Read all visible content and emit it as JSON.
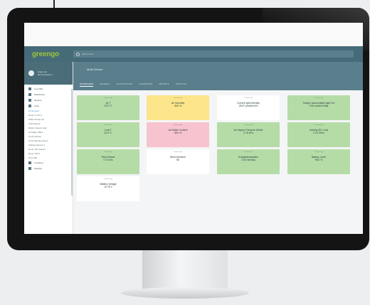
{
  "app": {
    "logo": "greengo",
    "search_placeholder": "Search here"
  },
  "user": {
    "name": "Hugo Lee",
    "company": "HQ Company ▾"
  },
  "sidebar": {
    "items": [
      {
        "label": "Live Map",
        "icon": "map-icon"
      },
      {
        "label": "Dashboard",
        "icon": "dashboard-icon"
      },
      {
        "label": "Reports",
        "icon": "reports-icon"
      },
      {
        "label": "Units",
        "icon": "units-icon"
      }
    ],
    "devices": [
      "All Sensors",
      "Room 1 Unit 1",
      "Office Printer 2A",
      "CO2 Sensor",
      "Motion Sensor Hall",
      "Humidity Office",
      "Temp Kitchen",
      "Temp Meeting Room",
      "Parking Sensor 1",
      "Room 101 Sensor",
      "Room 102 A",
      "Tour Hall"
    ],
    "bottom": [
      {
        "label": "Locations",
        "icon": "location-icon"
      },
      {
        "label": "Settings",
        "icon": "gear-icon"
      }
    ]
  },
  "device": {
    "title": "Multi-Sensor"
  },
  "tabs": [
    "DASHBOARD",
    "GENERAL",
    "NOTIFICATIONS",
    "DASHBOARD",
    "REPORTS",
    "RAW DATA"
  ],
  "tiles": [
    {
      "time": "2 minutes ago",
      "label": "Air T",
      "value": "23.5 °C",
      "color": "#b5dca7"
    },
    {
      "time": "2 minutes ago",
      "label": "Air Humidity",
      "value": "48.5 %",
      "color": "#fce58a"
    },
    {
      "time": "2 minutes ago",
      "label": "Current light intensity",
      "value": "28.67 µmols/m2/s",
      "color": "#ffffff"
    },
    {
      "time": "2 minutes ago",
      "label": "Today's accumulated light DLI",
      "value": "2.50 mols/m2/day",
      "color": "#b5dca7"
    },
    {
      "time": "2 minutes ago",
      "label": "Leaf T",
      "value": "22.5 °C",
      "color": "#b5dca7"
    },
    {
      "time": "2 minutes ago",
      "label": "Air Water Content",
      "value": "48.0 %",
      "color": "#f7c3cf"
    },
    {
      "time": "2 minutes ago",
      "label": "Air Vapour Pressure Deficit",
      "value": "0.78 kPa",
      "color": "#b5dca7"
    },
    {
      "time": "2 minutes ago",
      "label": "Salinity (EC root)",
      "value": "0.23 dS/m",
      "color": "#b5dca7"
    },
    {
      "time": "2 minutes ago",
      "label": "Wind Speed",
      "value": "0.73 m/s",
      "color": "#b5dca7"
    },
    {
      "time": "2 minutes ago",
      "label": "Wind Direction",
      "value": "SE",
      "color": "#ffffff"
    },
    {
      "time": "2 minutes ago",
      "label": "Evapotranspiration",
      "value": "1.53 mm/day",
      "color": "#b5dca7"
    },
    {
      "time": "2 minutes ago",
      "label": "Battery Level",
      "value": "98.0 %",
      "color": "#b5dca7"
    },
    {
      "time": "2 minutes ago",
      "label": "Battery Voltage",
      "value": "12.78 V",
      "color": "#ffffff"
    }
  ]
}
